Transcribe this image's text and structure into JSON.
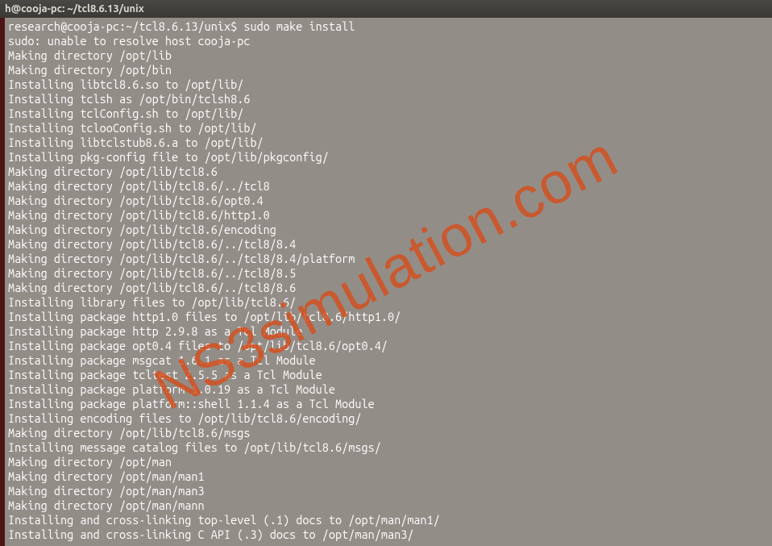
{
  "window": {
    "title": "h@cooja-pc: ~/tcl8.6.13/unix"
  },
  "terminal": {
    "prompt": "research@cooja-pc:~/tcl8.6.13/unix$ ",
    "command": "sudo make install",
    "lines": [
      "sudo: unable to resolve host cooja-pc",
      "Making directory /opt/lib",
      "Making directory /opt/bin",
      "Installing libtcl8.6.so to /opt/lib/",
      "Installing tclsh as /opt/bin/tclsh8.6",
      "Installing tclConfig.sh to /opt/lib/",
      "Installing tclooConfig.sh to /opt/lib/",
      "Installing libtclstub8.6.a to /opt/lib/",
      "Installing pkg-config file to /opt/lib/pkgconfig/",
      "Making directory /opt/lib/tcl8.6",
      "Making directory /opt/lib/tcl8.6/../tcl8",
      "Making directory /opt/lib/tcl8.6/opt0.4",
      "Making directory /opt/lib/tcl8.6/http1.0",
      "Making directory /opt/lib/tcl8.6/encoding",
      "Making directory /opt/lib/tcl8.6/../tcl8/8.4",
      "Making directory /opt/lib/tcl8.6/../tcl8/8.4/platform",
      "Making directory /opt/lib/tcl8.6/../tcl8/8.5",
      "Making directory /opt/lib/tcl8.6/../tcl8/8.6",
      "Installing library files to /opt/lib/tcl8.6/",
      "Installing package http1.0 files to /opt/lib/tcl8.6/http1.0/",
      "Installing package http 2.9.8 as a Tcl Module",
      "Installing package opt0.4 files to /opt/lib/tcl8.6/opt0.4/",
      "Installing package msgcat 1.6.1 as a Tcl Module",
      "Installing package tcltest 2.5.5 as a Tcl Module",
      "Installing package platform 1.0.19 as a Tcl Module",
      "Installing package platform::shell 1.1.4 as a Tcl Module",
      "Installing encoding files to /opt/lib/tcl8.6/encoding/",
      "Making directory /opt/lib/tcl8.6/msgs",
      "Installing message catalog files to /opt/lib/tcl8.6/msgs/",
      "Making directory /opt/man",
      "Making directory /opt/man/man1",
      "Making directory /opt/man/man3",
      "Making directory /opt/man/mann",
      "Installing and cross-linking top-level (.1) docs to /opt/man/man1/",
      "Installing and cross-linking C API (.3) docs to /opt/man/man3/"
    ]
  },
  "watermark": {
    "text": "NS3simulation.com"
  }
}
